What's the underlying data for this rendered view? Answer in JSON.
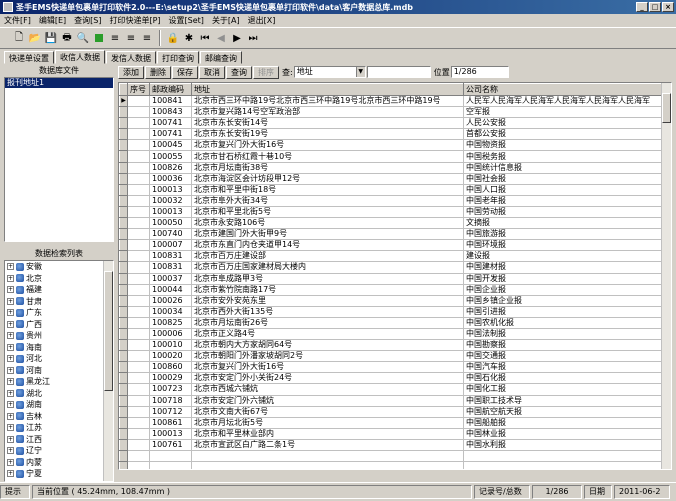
{
  "window": {
    "title": "圣手EMS快递单包裹单打印软件2.0---E:\\setup2\\圣手EMS快递单包裹单打印软件\\data\\客户数据总库.mdb",
    "min": "_",
    "max": "□",
    "close": "×"
  },
  "menu": [
    "文件[F]",
    "编辑[E]",
    "查询[S]",
    "打印快递单[P]",
    "设置[Set]",
    "关于[A]",
    "退出[X]"
  ],
  "tabs": [
    "快递单设置",
    "收信人数据",
    "发信人数据",
    "打印查询",
    "邮编查询"
  ],
  "left": {
    "db_header": "数据库文件",
    "db_items": [
      "报刊地址1"
    ],
    "search_header": "数据检索列表",
    "tree": [
      "安徽",
      "北京",
      "福建",
      "甘肃",
      "广东",
      "广西",
      "贵州",
      "海南",
      "河北",
      "河南",
      "黑龙江",
      "湖北",
      "湖南",
      "吉林",
      "江苏",
      "江西",
      "辽宁",
      "内蒙",
      "宁夏"
    ]
  },
  "actions": {
    "add": "添加",
    "delete": "删除",
    "save": "保存",
    "cancel": "取消",
    "query": "查询",
    "sort": "排序",
    "query_label": "查:",
    "query_field": "地址",
    "position_label": "位置",
    "position_value": "1/286"
  },
  "grid": {
    "headers": [
      "序号",
      "邮政编码",
      "地址",
      "公司名称"
    ],
    "rows": [
      [
        "100841",
        "北京市西三环中路19号北京市西三环中路19号北京市西三环中路19号",
        "人民军人民海军人民海军人民海军人民海军人民海军"
      ],
      [
        "100843",
        "北京市复兴路14号空军政治部",
        "空军报"
      ],
      [
        "100741",
        "北京市东长安街14号",
        "人民公安报"
      ],
      [
        "100741",
        "北京市东长安街19号",
        "首都公安报"
      ],
      [
        "100045",
        "北京市复兴门外大街16号",
        "中国物资报"
      ],
      [
        "100055",
        "北京市甘石桥红霞十巷10号",
        "中国税务报"
      ],
      [
        "100826",
        "北京市月坛南街38号",
        "中国统计信息报"
      ],
      [
        "100036",
        "北京市海淀区会计坊段甲12号",
        "中国社会报"
      ],
      [
        "100013",
        "北京市和平里中街18号",
        "中国人口报"
      ],
      [
        "100032",
        "北京市阜外大街34号",
        "中国老年报"
      ],
      [
        "100013",
        "北京市和平里北街5号",
        "中国劳动报"
      ],
      [
        "100050",
        "北京市永安路106号",
        "文摘报"
      ],
      [
        "100740",
        "北京市建国门外大街甲9号",
        "中国旅游报"
      ],
      [
        "100007",
        "北京市东直门内仓夹道甲14号",
        "中国环境报"
      ],
      [
        "100831",
        "北京市百万庄建设部",
        "建设报"
      ],
      [
        "100831",
        "北京市百万庄国家建材局大楼内",
        "中国建材报"
      ],
      [
        "100037",
        "北京市阜成路甲3号",
        "中国开发报"
      ],
      [
        "100044",
        "北京市紫竹院南路17号",
        "中国企业报"
      ],
      [
        "100026",
        "北京市安外安苑东里",
        "中国乡镇企业报"
      ],
      [
        "100034",
        "北京市西外大街135号",
        "中国引进报"
      ],
      [
        "100825",
        "北京市月坛南街26号",
        "中国农机化报"
      ],
      [
        "100006",
        "北京市正义路4号",
        "中国法制报"
      ],
      [
        "100010",
        "北京市朝内大方家胡同64号",
        "中国勘察报"
      ],
      [
        "100020",
        "北京市朝阳门外潘家坡胡同2号",
        "中国交通报"
      ],
      [
        "100860",
        "北京市复兴门外大街16号",
        "中国汽车报"
      ],
      [
        "100029",
        "北京市安定门外小关街24号",
        "中国石化报"
      ],
      [
        "100723",
        "北京市西城六铺炕",
        "中国化工报"
      ],
      [
        "100718",
        "北京市安定门外六铺炕",
        "中国职工技术导"
      ],
      [
        "100712",
        "北京市文南大街67号",
        "中国航空航天报"
      ],
      [
        "100861",
        "北京市月坛北街5号",
        "中国船舶报"
      ],
      [
        "100013",
        "北京市和平里林业部内",
        "中国林业报"
      ],
      [
        "100761",
        "北京市宣武区白广路二条1号",
        "中国水利报"
      ],
      [
        "",
        "",
        ""
      ],
      [
        "",
        "",
        ""
      ]
    ]
  },
  "status": {
    "hint": "提示",
    "position": "当前位置 ( 45.24mm, 108.47mm )",
    "record_label": "记录号/总数",
    "record_value": "1/286",
    "date_label": "日期",
    "date_value": "2011-06-2"
  }
}
